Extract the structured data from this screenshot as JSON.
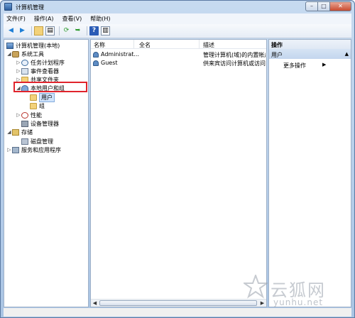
{
  "window": {
    "title": "计算机管理",
    "controls": {
      "minimize": "–",
      "maximize": "□",
      "close": "✕"
    }
  },
  "menu": [
    "文件(F)",
    "操作(A)",
    "查看(V)",
    "帮助(H)"
  ],
  "toolbar": {
    "icons": [
      "back-arrow-icon",
      "forward-arrow-icon",
      "folder-up-icon",
      "console-tree-icon",
      "refresh-icon",
      "export-icon",
      "help-icon",
      "show-pane-icon"
    ]
  },
  "tree": {
    "root": "计算机管理(本地)",
    "system_tools": "系统工具",
    "task_scheduler": "任务计划程序",
    "event_viewer": "事件查看器",
    "shared_folders": "共享文件夹",
    "local_users_groups": "本地用户和组",
    "users": "用户",
    "groups": "组",
    "performance": "性能",
    "device_manager": "设备管理器",
    "storage": "存储",
    "disk_management": "磁盘管理",
    "services_apps": "服务和应用程序"
  },
  "list": {
    "columns": {
      "name": "名称",
      "fullname": "全名",
      "description": "描述"
    },
    "rows": [
      {
        "name": "Administrat...",
        "fullname": "",
        "description": "管理计算机(域)的内置帐户"
      },
      {
        "name": "Guest",
        "fullname": "",
        "description": "供来宾访问计算机或访问域"
      }
    ]
  },
  "actions": {
    "header": "操作",
    "section": "用户",
    "more": "更多操作"
  },
  "watermark": {
    "name": "云狐网",
    "url": "yunhu.net"
  },
  "colors": {
    "selection": "#cfe3fb",
    "highlight_box": "#e0242c",
    "frame": "#a9c4e4"
  }
}
